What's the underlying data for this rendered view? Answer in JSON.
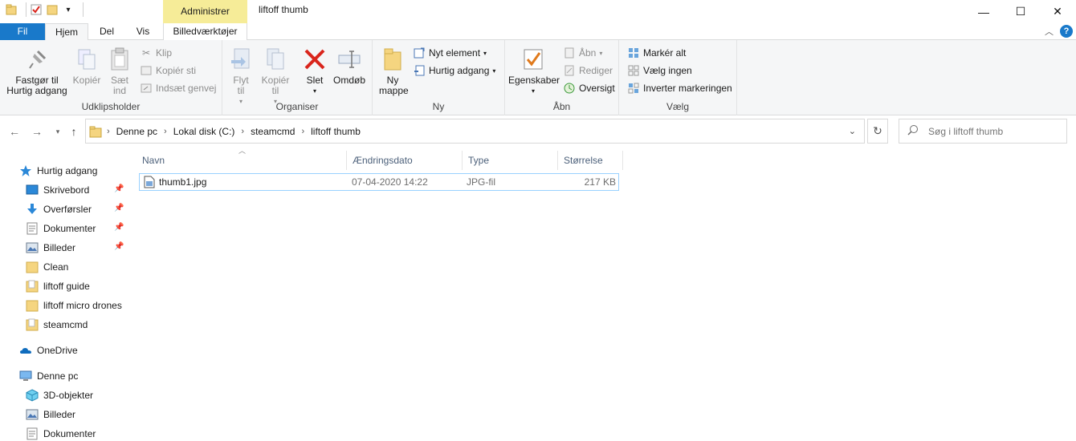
{
  "window": {
    "title": "liftoff thumb",
    "context_tab_header": "Administrer",
    "controls": {
      "minimize": "—",
      "maximize": "☐",
      "close": "✕"
    }
  },
  "ribbon_tabs": {
    "file": "Fil",
    "home": "Hjem",
    "share": "Del",
    "view": "Vis",
    "picture_tools": "Billedværktøjer"
  },
  "ribbon": {
    "clipboard": {
      "label": "Udklipsholder",
      "pin_quick": "Fastgør til Hurtig adgang",
      "copy": "Kopiér",
      "paste": "Sæt ind",
      "cut": "Klip",
      "copy_path": "Kopiér sti",
      "paste_shortcut": "Indsæt genvej"
    },
    "organize": {
      "label": "Organiser",
      "move_to": "Flyt til",
      "copy_to": "Kopiér til",
      "delete": "Slet",
      "rename": "Omdøb"
    },
    "new": {
      "label": "Ny",
      "new_folder": "Ny mappe",
      "new_item": "Nyt element",
      "easy_access": "Hurtig adgang"
    },
    "open": {
      "label": "Åbn",
      "properties": "Egenskaber",
      "open": "Åbn",
      "edit": "Rediger",
      "history": "Oversigt"
    },
    "select": {
      "label": "Vælg",
      "select_all": "Markér alt",
      "select_none": "Vælg ingen",
      "invert": "Inverter markeringen"
    }
  },
  "address": {
    "crumbs": [
      "Denne pc",
      "Lokal disk (C:)",
      "steamcmd",
      "liftoff thumb"
    ]
  },
  "search": {
    "placeholder": "Søg i liftoff thumb"
  },
  "nav": {
    "quick_access": "Hurtig adgang",
    "items": [
      {
        "label": "Skrivebord",
        "pinned": true
      },
      {
        "label": "Overførsler",
        "pinned": true
      },
      {
        "label": "Dokumenter",
        "pinned": true
      },
      {
        "label": "Billeder",
        "pinned": true
      },
      {
        "label": "Clean",
        "pinned": false
      },
      {
        "label": "liftoff guide",
        "pinned": false
      },
      {
        "label": "liftoff micro drones",
        "pinned": false
      },
      {
        "label": "steamcmd",
        "pinned": false
      }
    ],
    "onedrive": "OneDrive",
    "this_pc": "Denne pc",
    "pc_items": [
      "3D-objekter",
      "Billeder",
      "Dokumenter"
    ]
  },
  "columns": {
    "name": "Navn",
    "date": "Ændringsdato",
    "type": "Type",
    "size": "Størrelse"
  },
  "files": [
    {
      "name": "thumb1.jpg",
      "date": "07-04-2020 14:22",
      "type": "JPG-fil",
      "size": "217 KB"
    }
  ],
  "colors": {
    "accent": "#1979ca",
    "context_tab": "#f6ec98",
    "folder": "#f5d580",
    "delete_red": "#d9251c"
  }
}
